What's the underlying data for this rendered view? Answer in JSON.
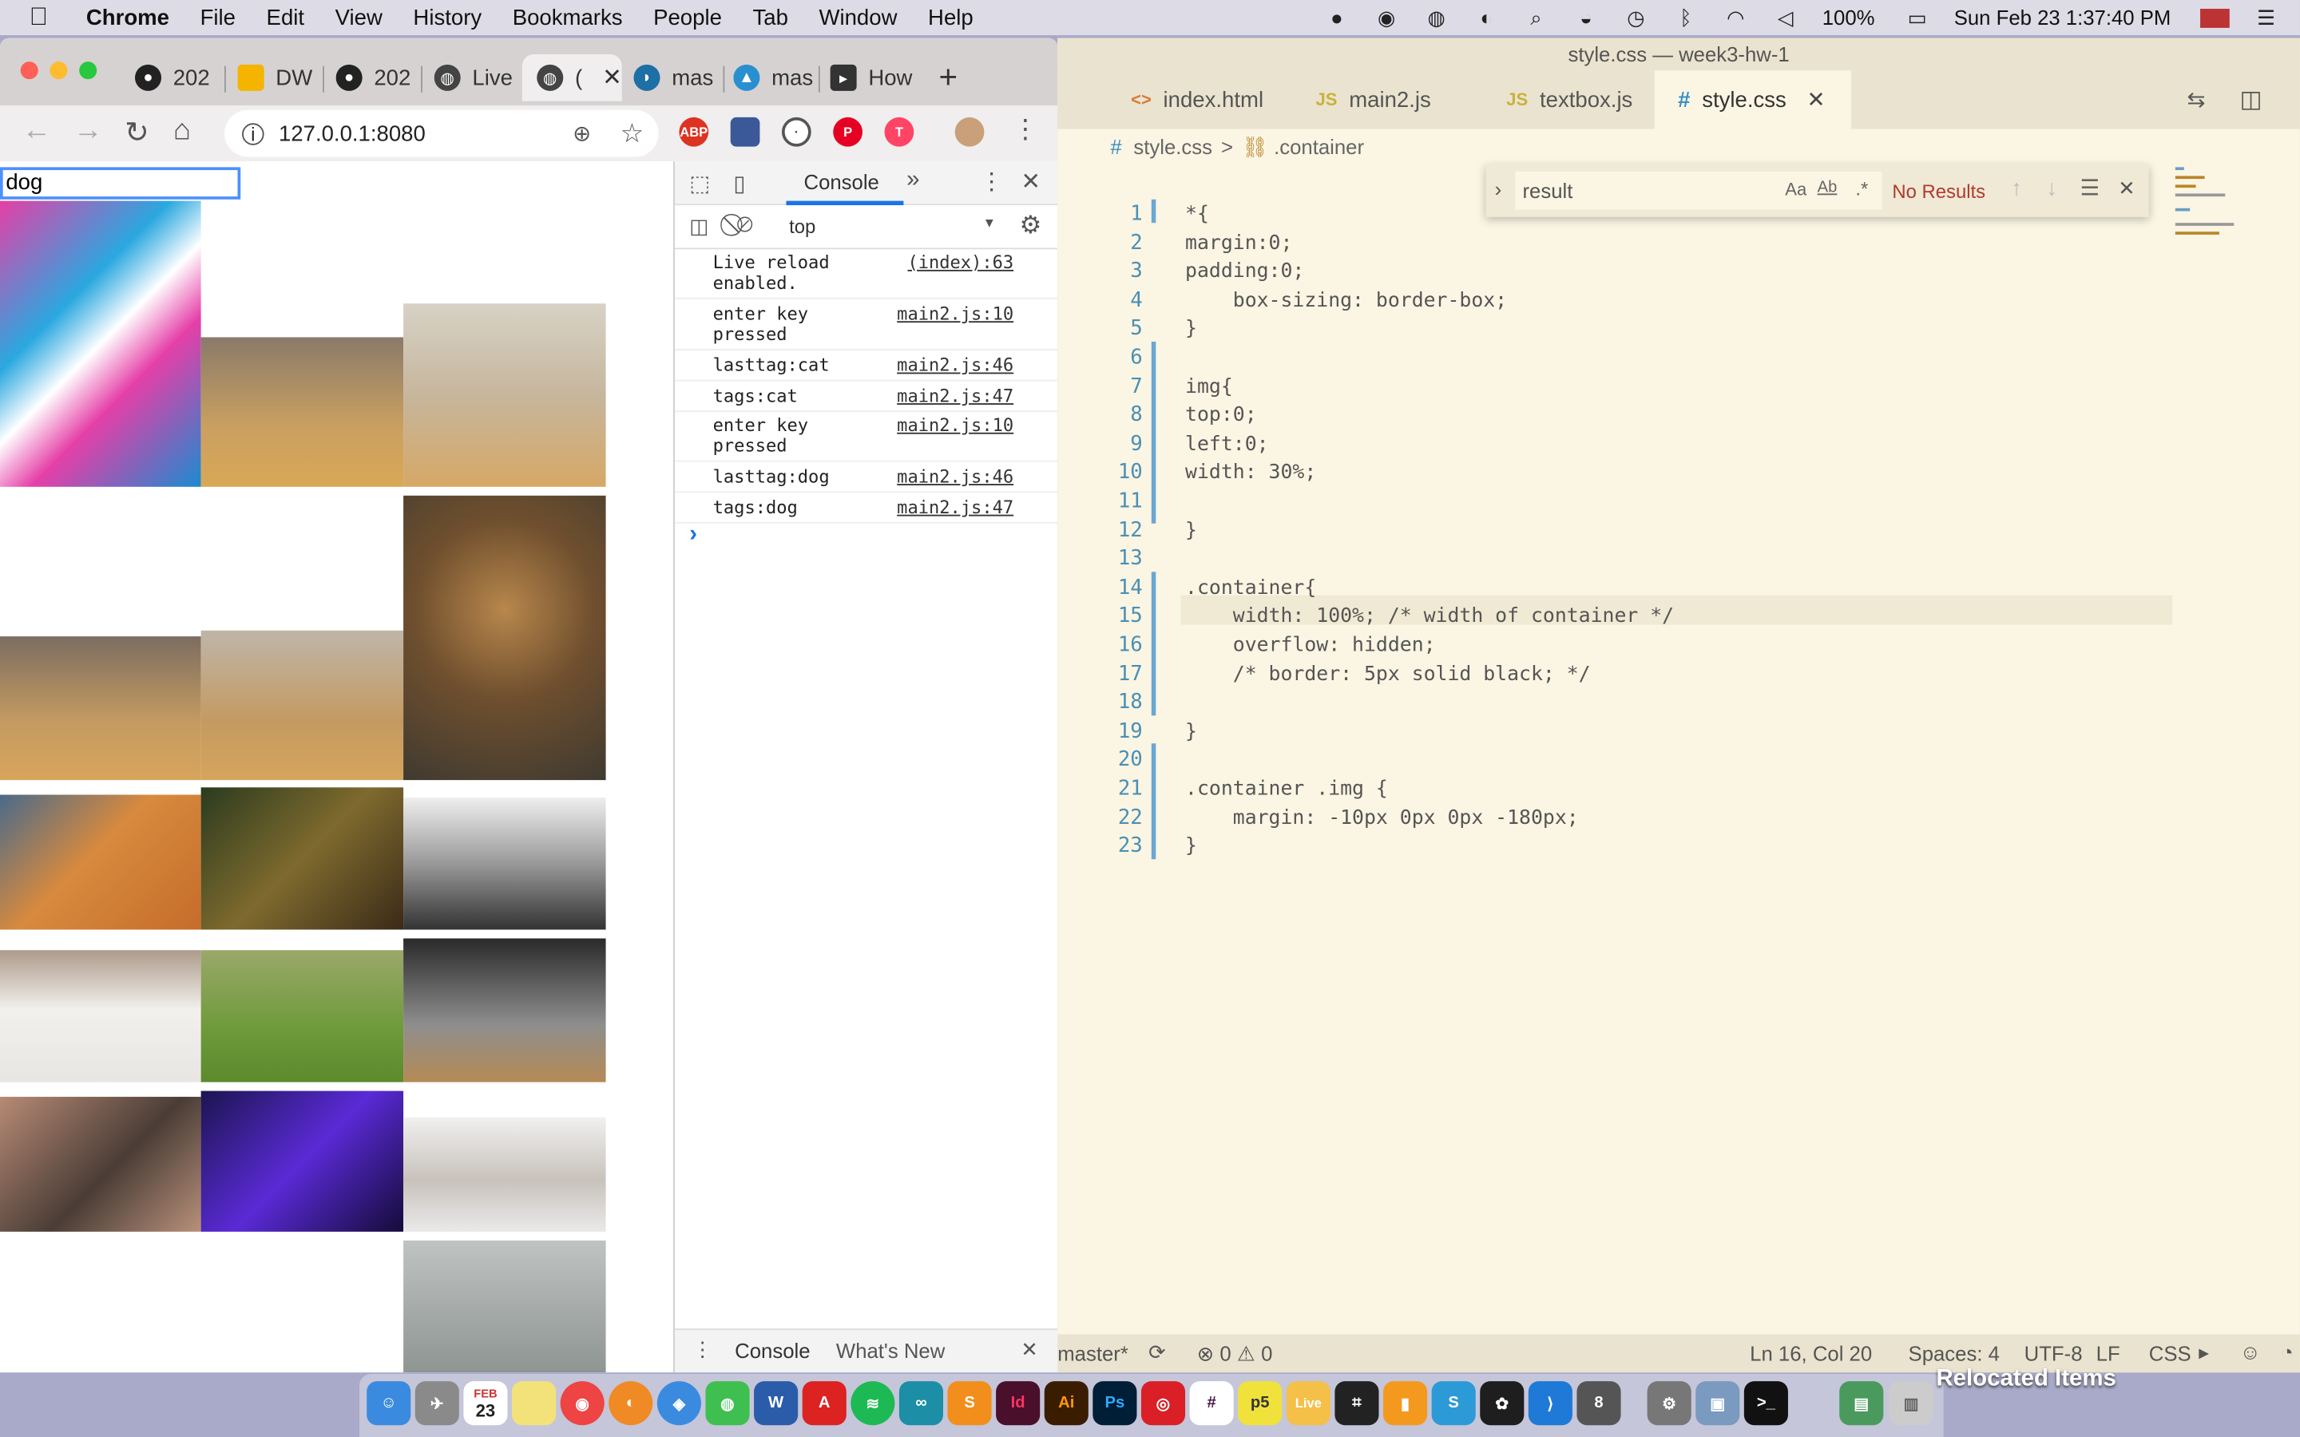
{
  "menubar": {
    "apple": "",
    "app": "Chrome",
    "items": [
      "File",
      "Edit",
      "View",
      "History",
      "Bookmarks",
      "People",
      "Tab",
      "Window",
      "Help"
    ],
    "battery": "100%",
    "datetime": "Sun Feb 23  1:37:40 PM"
  },
  "chrome": {
    "tabs": [
      {
        "label": "202",
        "icon": "github-icon"
      },
      {
        "label": "DW",
        "icon": "slides-icon"
      },
      {
        "label": "202",
        "icon": "github-icon"
      },
      {
        "label": "Live",
        "icon": "globe-icon"
      },
      {
        "label": "(",
        "icon": "globe-icon"
      },
      {
        "label": "mas",
        "icon": "mastodon-icon"
      },
      {
        "label": "mas",
        "icon": "drop-icon"
      },
      {
        "label": "How",
        "icon": "terminal-icon"
      }
    ],
    "url": "127.0.0.1:8080",
    "extensions": [
      "ABP",
      "",
      "",
      "",
      ""
    ]
  },
  "page": {
    "search_value": "dog"
  },
  "devtools": {
    "tab_console": "Console",
    "context": "top",
    "logs": [
      {
        "msg": "Live reload enabled.",
        "src": "(index):63"
      },
      {
        "msg": "enter key pressed",
        "src": "main2.js:10"
      },
      {
        "msg": "lasttag:cat",
        "src": "main2.js:46"
      },
      {
        "msg": "tags:cat",
        "src": "main2.js:47"
      },
      {
        "msg": "enter key pressed",
        "src": "main2.js:10"
      },
      {
        "msg": "lasttag:dog",
        "src": "main2.js:46"
      },
      {
        "msg": "tags:dog",
        "src": "main2.js:47"
      }
    ],
    "prompt": "›",
    "drawer_console": "Console",
    "drawer_whatsnew": "What's New"
  },
  "vscode": {
    "title": "style.css — week3-hw-1",
    "tabs": [
      {
        "label": "index.html",
        "icon": "<>",
        "color": "#d97a3a"
      },
      {
        "label": "main2.js",
        "icon": "JS",
        "color": "#c9b23a"
      },
      {
        "label": "textbox.js",
        "icon": "JS",
        "color": "#c9b23a"
      },
      {
        "label": "style.css",
        "icon": "#",
        "color": "#3b8dc4"
      }
    ],
    "breadcrumb": {
      "file": "style.css",
      "sep": ">",
      "symbol": ".container"
    },
    "find": {
      "query": "result",
      "result": "No Results"
    },
    "lines": [
      "*{",
      "margin:0;",
      "padding:0;",
      "    box-sizing: border-box;",
      "}",
      "",
      "img{",
      "top:0;",
      "left:0;",
      "width: 30%;",
      "",
      "}",
      "",
      ".container{",
      "    width: 100%; /* width of container */",
      "    overflow: hidden;",
      "    /* border: 5px solid black; */",
      "",
      "}",
      "",
      ".container .img {",
      "    margin: -10px 0px 0px -180px;",
      "}"
    ],
    "status": {
      "branch": "master*",
      "problems": "⊗ 0 ⚠ 0",
      "position": "Ln 16, Col 20",
      "spaces": "Spaces: 4",
      "encoding": "UTF-8",
      "eol": "LF",
      "lang": "CSS"
    }
  },
  "dock": {
    "relocated": "Relocated Items",
    "calendar_month": "FEB",
    "calendar_day": "23"
  },
  "colors": {
    "desktop": "#a9aac9",
    "vscode_bg": "#fbf5e3",
    "accent_blue": "#4d90fe",
    "no_results": "#b03a2e"
  }
}
